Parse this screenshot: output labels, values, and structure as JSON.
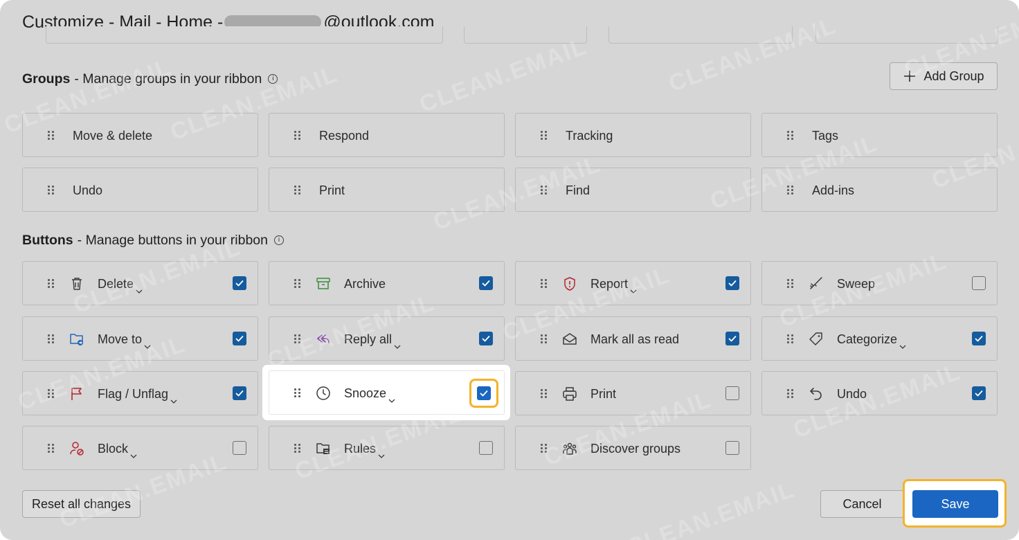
{
  "dialog": {
    "title_prefix": "Customize - Mail - Home - ",
    "title_suffix": "@outlook.com"
  },
  "groups_section": {
    "title_bold": "Groups",
    "title_rest": "- Manage groups in your ribbon",
    "add_group_label": "Add Group",
    "items": [
      {
        "label": "Move & delete"
      },
      {
        "label": "Respond"
      },
      {
        "label": "Tracking"
      },
      {
        "label": "Tags"
      },
      {
        "label": "Undo"
      },
      {
        "label": "Print"
      },
      {
        "label": "Find"
      },
      {
        "label": "Add-ins"
      }
    ]
  },
  "buttons_section": {
    "title_bold": "Buttons",
    "title_rest": "- Manage buttons in your ribbon",
    "items": [
      {
        "label": "Delete",
        "icon": "trash-icon",
        "dropdown": true,
        "checked": true
      },
      {
        "label": "Archive",
        "icon": "archive-icon",
        "dropdown": false,
        "checked": true
      },
      {
        "label": "Report",
        "icon": "shield-alert-icon",
        "dropdown": true,
        "checked": true
      },
      {
        "label": "Sweep",
        "icon": "broom-icon",
        "dropdown": false,
        "checked": false
      },
      {
        "label": "Move to",
        "icon": "folder-move-icon",
        "dropdown": true,
        "checked": true
      },
      {
        "label": "Reply all",
        "icon": "reply-all-icon",
        "dropdown": true,
        "checked": true
      },
      {
        "label": "Mark all as read",
        "icon": "envelope-open-icon",
        "dropdown": false,
        "checked": true
      },
      {
        "label": "Categorize",
        "icon": "tag-icon",
        "dropdown": true,
        "checked": true
      },
      {
        "label": "Flag / Unflag",
        "icon": "flag-icon",
        "dropdown": true,
        "checked": true
      },
      {
        "label": "Snooze",
        "icon": "clock-icon",
        "dropdown": true,
        "checked": true,
        "highlighted": true
      },
      {
        "label": "Print",
        "icon": "printer-icon",
        "dropdown": false,
        "checked": false
      },
      {
        "label": "Undo",
        "icon": "undo-icon",
        "dropdown": false,
        "checked": true
      },
      {
        "label": "Block",
        "icon": "block-user-icon",
        "dropdown": true,
        "checked": false
      },
      {
        "label": "Rules",
        "icon": "folder-rules-icon",
        "dropdown": true,
        "checked": false
      },
      {
        "label": "Discover groups",
        "icon": "people-group-icon",
        "dropdown": false,
        "checked": false
      }
    ]
  },
  "footer": {
    "reset_label": "Reset all changes",
    "cancel_label": "Cancel",
    "save_label": "Save"
  },
  "watermark_text": "CLEAN.EMAIL",
  "colors": {
    "accent": "#1a66c2",
    "highlight": "#f3b329",
    "checkbox": "#155b9e",
    "overlay": "#d6d6d6"
  }
}
